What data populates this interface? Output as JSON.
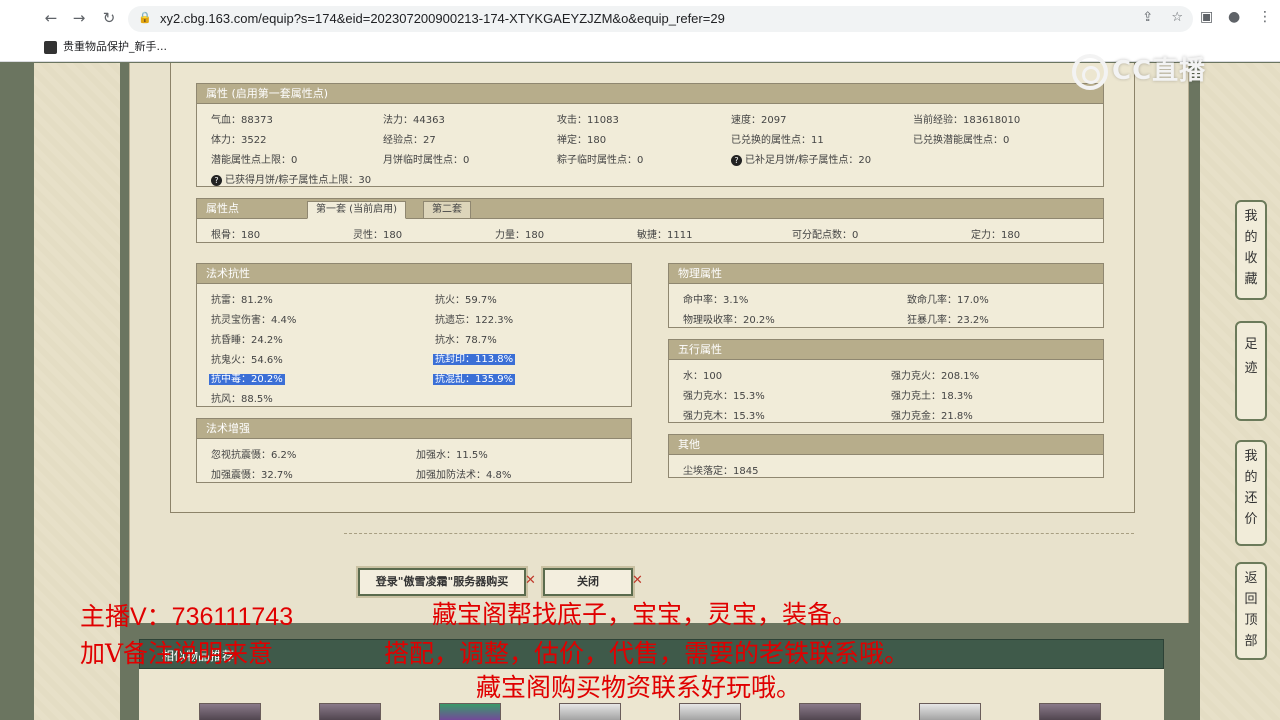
{
  "browser": {
    "url": "xy2.cbg.163.com/equip?s=174&eid=202307200900213-174-XTYKGAEYZJZM&o&equip_refer=29",
    "bookmark": "贵重物品保护_新手..."
  },
  "logo": {
    "text": "CC直播"
  },
  "attributes": {
    "title": "属性 (启用第一套属性点)",
    "rows": [
      [
        "气血：88373",
        "法力：44363",
        "攻击：11083",
        "速度：2097",
        "当前经验：183618010"
      ],
      [
        "体力：3522",
        "经验点：27",
        "禅定：180",
        "已兑换的属性点：11",
        "已兑换潜能属性点：0"
      ],
      [
        "潜能属性点上限：0",
        "月饼临时属性点：0",
        "粽子临时属性点：0",
        "已补足月饼/粽子属性点：20"
      ],
      [
        "已获得月饼/粽子属性点上限：30"
      ]
    ]
  },
  "points": {
    "title": "属性点",
    "tabs": [
      "第一套 (当前启用)",
      "第二套"
    ],
    "values": [
      "根骨：180",
      "灵性：180",
      "力量：180",
      "敏捷：1111",
      "可分配点数：0",
      "定力：180"
    ]
  },
  "resist": {
    "title": "法术抗性",
    "rows": [
      [
        "抗雷：81.2%",
        "抗火：59.7%"
      ],
      [
        "抗灵宝伤害：4.4%",
        "抗遗忘：122.3%"
      ],
      [
        "抗昏睡：24.2%",
        "抗水：78.7%"
      ],
      [
        "抗鬼火：54.6%",
        "抗封印：113.8%"
      ],
      [
        "抗中毒：20.2%",
        "抗混乱：135.9%"
      ],
      [
        "抗风：88.5%"
      ]
    ]
  },
  "enhance": {
    "title": "法术增强",
    "rows": [
      [
        "忽视抗震慑：6.2%",
        "加强水：11.5%"
      ],
      [
        "加强震慑：32.7%",
        "加强加防法术：4.8%"
      ]
    ]
  },
  "physical": {
    "title": "物理属性",
    "rows": [
      [
        "命中率：3.1%",
        "致命几率：17.0%"
      ],
      [
        "物理吸收率：20.2%",
        "狂暴几率：23.2%"
      ]
    ]
  },
  "wuxing": {
    "title": "五行属性",
    "rows": [
      [
        "水：100",
        "强力克火：208.1%"
      ],
      [
        "强力克水：15.3%",
        "强力克土：18.3%"
      ],
      [
        "强力克木：15.3%",
        "强力克金：21.8%"
      ]
    ]
  },
  "other": {
    "title": "其他",
    "rows": [
      [
        "尘埃落定：1845"
      ]
    ]
  },
  "buttons": {
    "login": "登录\"傲雪凌霜\"服务器购买",
    "close": "关闭"
  },
  "similar": {
    "title": "相似物品推荐"
  },
  "side": {
    "favorites": "我的收藏",
    "footprint": "足迹",
    "bargain": "我的还价",
    "top": "返回顶部"
  },
  "overlay": {
    "line1a": "主播V：736111743",
    "line1b": "藏宝阁帮找底子，宝宝，灵宝，装备。",
    "line2a": "加V备注说明来意",
    "line2b": "搭配，调整，估价，代售，需要的老铁联系哦。",
    "line3": "藏宝阁购买物资联系好玩哦。"
  }
}
